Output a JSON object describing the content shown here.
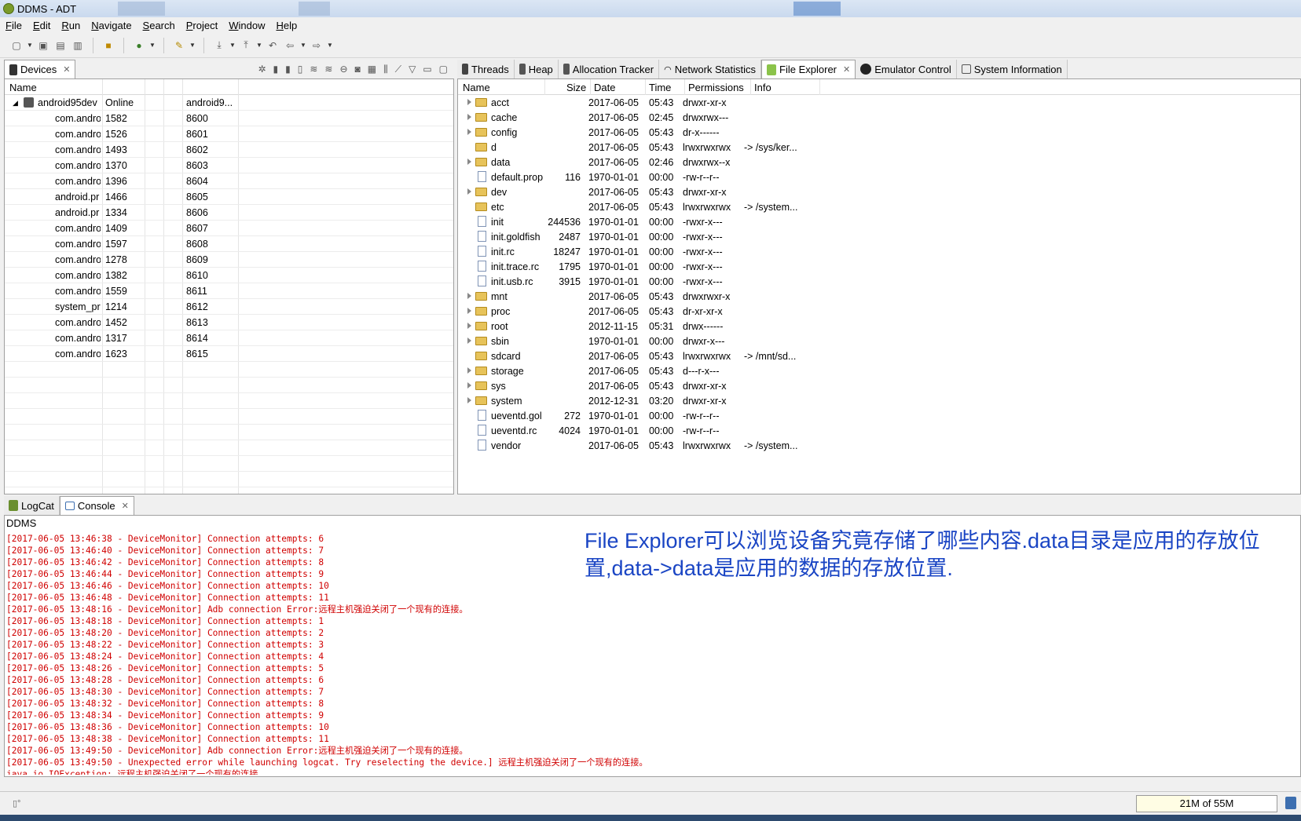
{
  "window": {
    "title": "DDMS - ADT"
  },
  "menu": [
    "File",
    "Edit",
    "Run",
    "Navigate",
    "Search",
    "Project",
    "Window",
    "Help"
  ],
  "devices_panel": {
    "tab_label": "Devices",
    "columns": [
      "Name"
    ],
    "device": {
      "name": "android95dev",
      "status": "Online",
      "serial": "android9..."
    },
    "processes": [
      {
        "name": "com.andro",
        "pid": "1582",
        "port": "8600"
      },
      {
        "name": "com.andro",
        "pid": "1526",
        "port": "8601"
      },
      {
        "name": "com.andro",
        "pid": "1493",
        "port": "8602"
      },
      {
        "name": "com.andro",
        "pid": "1370",
        "port": "8603"
      },
      {
        "name": "com.andro",
        "pid": "1396",
        "port": "8604"
      },
      {
        "name": "android.pr",
        "pid": "1466",
        "port": "8605"
      },
      {
        "name": "android.pr",
        "pid": "1334",
        "port": "8606"
      },
      {
        "name": "com.andro",
        "pid": "1409",
        "port": "8607"
      },
      {
        "name": "com.andro",
        "pid": "1597",
        "port": "8608"
      },
      {
        "name": "com.andro",
        "pid": "1278",
        "port": "8609"
      },
      {
        "name": "com.andro",
        "pid": "1382",
        "port": "8610"
      },
      {
        "name": "com.andro",
        "pid": "1559",
        "port": "8611"
      },
      {
        "name": "system_prc",
        "pid": "1214",
        "port": "8612"
      },
      {
        "name": "com.andro",
        "pid": "1452",
        "port": "8613"
      },
      {
        "name": "com.andro",
        "pid": "1317",
        "port": "8614"
      },
      {
        "name": "com.andro",
        "pid": "1623",
        "port": "8615"
      }
    ]
  },
  "right_tabs": [
    "Threads",
    "Heap",
    "Allocation Tracker",
    "Network Statistics",
    "File Explorer",
    "Emulator Control",
    "System Information"
  ],
  "file_explorer": {
    "columns": [
      "Name",
      "Size",
      "Date",
      "Time",
      "Permissions",
      "Info"
    ],
    "rows": [
      {
        "name": "acct",
        "type": "folder",
        "expand": true,
        "size": "",
        "date": "2017-06-05",
        "time": "05:43",
        "perm": "drwxr-xr-x",
        "info": ""
      },
      {
        "name": "cache",
        "type": "folder",
        "expand": true,
        "size": "",
        "date": "2017-06-05",
        "time": "02:45",
        "perm": "drwxrwx---",
        "info": ""
      },
      {
        "name": "config",
        "type": "folder",
        "expand": true,
        "size": "",
        "date": "2017-06-05",
        "time": "05:43",
        "perm": "dr-x------",
        "info": ""
      },
      {
        "name": "d",
        "type": "folder",
        "expand": false,
        "size": "",
        "date": "2017-06-05",
        "time": "05:43",
        "perm": "lrwxrwxrwx",
        "info": "-> /sys/ker..."
      },
      {
        "name": "data",
        "type": "folder",
        "expand": true,
        "size": "",
        "date": "2017-06-05",
        "time": "02:46",
        "perm": "drwxrwx--x",
        "info": ""
      },
      {
        "name": "default.prop",
        "type": "file",
        "expand": false,
        "size": "116",
        "date": "1970-01-01",
        "time": "00:00",
        "perm": "-rw-r--r--",
        "info": ""
      },
      {
        "name": "dev",
        "type": "folder",
        "expand": true,
        "size": "",
        "date": "2017-06-05",
        "time": "05:43",
        "perm": "drwxr-xr-x",
        "info": ""
      },
      {
        "name": "etc",
        "type": "folder",
        "expand": false,
        "size": "",
        "date": "2017-06-05",
        "time": "05:43",
        "perm": "lrwxrwxrwx",
        "info": "-> /system..."
      },
      {
        "name": "init",
        "type": "file",
        "expand": false,
        "size": "244536",
        "date": "1970-01-01",
        "time": "00:00",
        "perm": "-rwxr-x---",
        "info": ""
      },
      {
        "name": "init.goldfish",
        "type": "file",
        "expand": false,
        "size": "2487",
        "date": "1970-01-01",
        "time": "00:00",
        "perm": "-rwxr-x---",
        "info": ""
      },
      {
        "name": "init.rc",
        "type": "file",
        "expand": false,
        "size": "18247",
        "date": "1970-01-01",
        "time": "00:00",
        "perm": "-rwxr-x---",
        "info": ""
      },
      {
        "name": "init.trace.rc",
        "type": "file",
        "expand": false,
        "size": "1795",
        "date": "1970-01-01",
        "time": "00:00",
        "perm": "-rwxr-x---",
        "info": ""
      },
      {
        "name": "init.usb.rc",
        "type": "file",
        "expand": false,
        "size": "3915",
        "date": "1970-01-01",
        "time": "00:00",
        "perm": "-rwxr-x---",
        "info": ""
      },
      {
        "name": "mnt",
        "type": "folder",
        "expand": true,
        "size": "",
        "date": "2017-06-05",
        "time": "05:43",
        "perm": "drwxrwxr-x",
        "info": ""
      },
      {
        "name": "proc",
        "type": "folder",
        "expand": true,
        "size": "",
        "date": "2017-06-05",
        "time": "05:43",
        "perm": "dr-xr-xr-x",
        "info": ""
      },
      {
        "name": "root",
        "type": "folder",
        "expand": true,
        "size": "",
        "date": "2012-11-15",
        "time": "05:31",
        "perm": "drwx------",
        "info": ""
      },
      {
        "name": "sbin",
        "type": "folder",
        "expand": true,
        "size": "",
        "date": "1970-01-01",
        "time": "00:00",
        "perm": "drwxr-x---",
        "info": ""
      },
      {
        "name": "sdcard",
        "type": "folder",
        "expand": false,
        "size": "",
        "date": "2017-06-05",
        "time": "05:43",
        "perm": "lrwxrwxrwx",
        "info": "-> /mnt/sd..."
      },
      {
        "name": "storage",
        "type": "folder",
        "expand": true,
        "size": "",
        "date": "2017-06-05",
        "time": "05:43",
        "perm": "d---r-x---",
        "info": ""
      },
      {
        "name": "sys",
        "type": "folder",
        "expand": true,
        "size": "",
        "date": "2017-06-05",
        "time": "05:43",
        "perm": "drwxr-xr-x",
        "info": ""
      },
      {
        "name": "system",
        "type": "folder",
        "expand": true,
        "size": "",
        "date": "2012-12-31",
        "time": "03:20",
        "perm": "drwxr-xr-x",
        "info": ""
      },
      {
        "name": "ueventd.gol",
        "type": "file",
        "expand": false,
        "size": "272",
        "date": "1970-01-01",
        "time": "00:00",
        "perm": "-rw-r--r--",
        "info": ""
      },
      {
        "name": "ueventd.rc",
        "type": "file",
        "expand": false,
        "size": "4024",
        "date": "1970-01-01",
        "time": "00:00",
        "perm": "-rw-r--r--",
        "info": ""
      },
      {
        "name": "vendor",
        "type": "file",
        "expand": false,
        "size": "",
        "date": "2017-06-05",
        "time": "05:43",
        "perm": "lrwxrwxrwx",
        "info": "-> /system..."
      }
    ]
  },
  "console": {
    "tabs": [
      "LogCat",
      "Console"
    ],
    "title": "DDMS",
    "lines": [
      "[2017-06-05 13:46:38 - DeviceMonitor] Connection attempts: 6",
      "[2017-06-05 13:46:40 - DeviceMonitor] Connection attempts: 7",
      "[2017-06-05 13:46:42 - DeviceMonitor] Connection attempts: 8",
      "[2017-06-05 13:46:44 - DeviceMonitor] Connection attempts: 9",
      "[2017-06-05 13:46:46 - DeviceMonitor] Connection attempts: 10",
      "[2017-06-05 13:46:48 - DeviceMonitor] Connection attempts: 11",
      "[2017-06-05 13:48:16 - DeviceMonitor] Adb connection Error:远程主机强迫关闭了一个现有的连接。",
      "[2017-06-05 13:48:18 - DeviceMonitor] Connection attempts: 1",
      "[2017-06-05 13:48:20 - DeviceMonitor] Connection attempts: 2",
      "[2017-06-05 13:48:22 - DeviceMonitor] Connection attempts: 3",
      "[2017-06-05 13:48:24 - DeviceMonitor] Connection attempts: 4",
      "[2017-06-05 13:48:26 - DeviceMonitor] Connection attempts: 5",
      "[2017-06-05 13:48:28 - DeviceMonitor] Connection attempts: 6",
      "[2017-06-05 13:48:30 - DeviceMonitor] Connection attempts: 7",
      "[2017-06-05 13:48:32 - DeviceMonitor] Connection attempts: 8",
      "[2017-06-05 13:48:34 - DeviceMonitor] Connection attempts: 9",
      "[2017-06-05 13:48:36 - DeviceMonitor] Connection attempts: 10",
      "[2017-06-05 13:48:38 - DeviceMonitor] Connection attempts: 11",
      "[2017-06-05 13:49:50 - DeviceMonitor] Adb connection Error:远程主机强迫关闭了一个现有的连接。",
      "[2017-06-05 13:49:50 - Unexpected error while launching logcat. Try reselecting the device.] 远程主机强迫关闭了一个现有的连接。",
      "java.io.IOException: 远程主机强迫关闭了一个现有的连接。"
    ],
    "annotation": "File Explorer可以浏览设备究竟存储了哪些内容.data目录是应用的存放位置,data->data是应用的数据的存放位置."
  },
  "status": {
    "heap": "21M of 55M",
    "heap_used_fraction": 0.38
  },
  "colors": {
    "annotation": "#1a45c4",
    "log": "#d00000"
  }
}
